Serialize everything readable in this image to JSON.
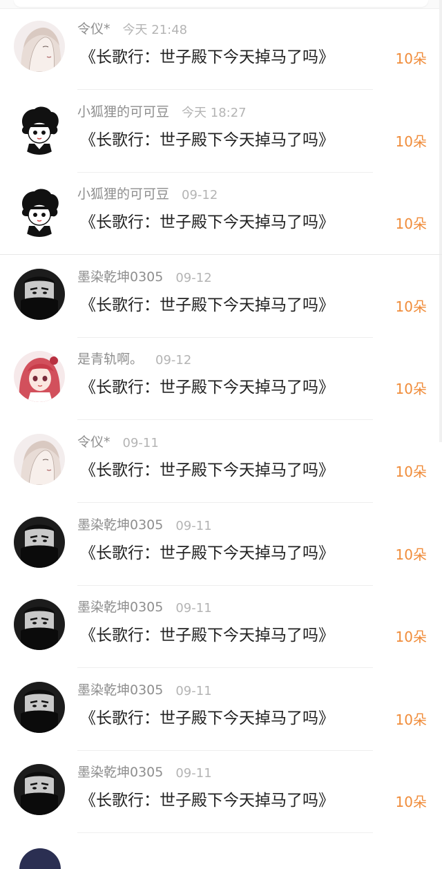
{
  "items": [
    {
      "user": "令仪*",
      "time": "今天 21:48",
      "title": "《长歌行：世子殿下今天掉马了吗》",
      "amount": "10朵",
      "avatar": "girl-sketch"
    },
    {
      "user": "小狐狸的可可豆",
      "time": "今天 18:27",
      "title": "《长歌行：世子殿下今天掉马了吗》",
      "amount": "10朵",
      "avatar": "cartoon-boy"
    },
    {
      "user": "小狐狸的可可豆",
      "time": "09-12",
      "title": "《长歌行：世子殿下今天掉马了吗》",
      "amount": "10朵",
      "avatar": "cartoon-boy"
    },
    {
      "user": "墨染乾坤0305",
      "time": "09-12",
      "title": "《长歌行：世子殿下今天掉马了吗》",
      "amount": "10朵",
      "avatar": "masked-man"
    },
    {
      "user": "是青轨啊。",
      "time": "09-12",
      "title": "《长歌行：世子殿下今天掉马了吗》",
      "amount": "10朵",
      "avatar": "red-hair-girl"
    },
    {
      "user": "令仪*",
      "time": "09-11",
      "title": "《长歌行：世子殿下今天掉马了吗》",
      "amount": "10朵",
      "avatar": "girl-sketch"
    },
    {
      "user": "墨染乾坤0305",
      "time": "09-11",
      "title": "《长歌行：世子殿下今天掉马了吗》",
      "amount": "10朵",
      "avatar": "masked-man"
    },
    {
      "user": "墨染乾坤0305",
      "time": "09-11",
      "title": "《长歌行：世子殿下今天掉马了吗》",
      "amount": "10朵",
      "avatar": "masked-man"
    },
    {
      "user": "墨染乾坤0305",
      "time": "09-11",
      "title": "《长歌行：世子殿下今天掉马了吗》",
      "amount": "10朵",
      "avatar": "masked-man"
    },
    {
      "user": "墨染乾坤0305",
      "time": "09-11",
      "title": "《长歌行：世子殿下今天掉马了吗》",
      "amount": "10朵",
      "avatar": "masked-man"
    }
  ],
  "colors": {
    "amount": "#f08c3a",
    "username": "#8e8e8e",
    "time": "#b4b4b4",
    "title": "#222222"
  }
}
